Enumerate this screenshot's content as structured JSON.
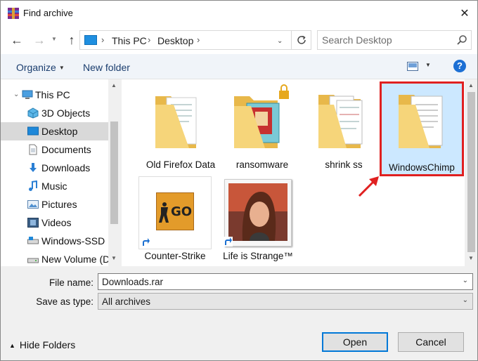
{
  "window": {
    "title": "Find archive",
    "close_glyph": "✕"
  },
  "navigation": {
    "back_glyph": "←",
    "forward_glyph": "→",
    "up_glyph": "↑",
    "breadcrumb": [
      "This PC",
      "Desktop"
    ],
    "search_placeholder": "Search Desktop"
  },
  "toolbar": {
    "organize_label": "Organize",
    "new_folder_label": "New folder",
    "help_glyph": "?"
  },
  "sidebar": {
    "items": [
      {
        "label": "This PC",
        "icon": "computer-icon",
        "indent": 0
      },
      {
        "label": "3D Objects",
        "icon": "cube-icon",
        "indent": 1
      },
      {
        "label": "Desktop",
        "icon": "desktop-icon",
        "indent": 1,
        "selected": true
      },
      {
        "label": "Documents",
        "icon": "document-icon",
        "indent": 1
      },
      {
        "label": "Downloads",
        "icon": "download-arrow-icon",
        "indent": 1
      },
      {
        "label": "Music",
        "icon": "music-note-icon",
        "indent": 1
      },
      {
        "label": "Pictures",
        "icon": "picture-icon",
        "indent": 1
      },
      {
        "label": "Videos",
        "icon": "film-icon",
        "indent": 1
      },
      {
        "label": "Windows-SSD (C",
        "icon": "drive-icon",
        "indent": 1
      },
      {
        "label": "New Volume (D:)",
        "icon": "drive-icon",
        "indent": 1
      }
    ]
  },
  "files": [
    {
      "label": "Old Firefox Data",
      "icon": "folder-icon"
    },
    {
      "label": "ransomware",
      "icon": "folder-locked-icon"
    },
    {
      "label": "shrink ss",
      "icon": "folder-icon"
    },
    {
      "label": "WindowsChimp",
      "icon": "folder-icon",
      "highlighted": true
    },
    {
      "label": "Counter-Strike",
      "icon": "shortcut-icon"
    },
    {
      "label": "Life is Strange™",
      "icon": "shortcut-icon"
    }
  ],
  "shortcut_logo_text": "GO",
  "form": {
    "file_name_label": "File name:",
    "file_name_value": "Downloads.rar",
    "save_type_label": "Save as type:",
    "save_type_value": "All archives"
  },
  "footer": {
    "hide_folders_label": "Hide Folders",
    "open_label": "Open",
    "cancel_label": "Cancel"
  },
  "colors": {
    "highlight_border": "#e02020",
    "accent": "#0078d7",
    "folder": "#f4c95d"
  }
}
